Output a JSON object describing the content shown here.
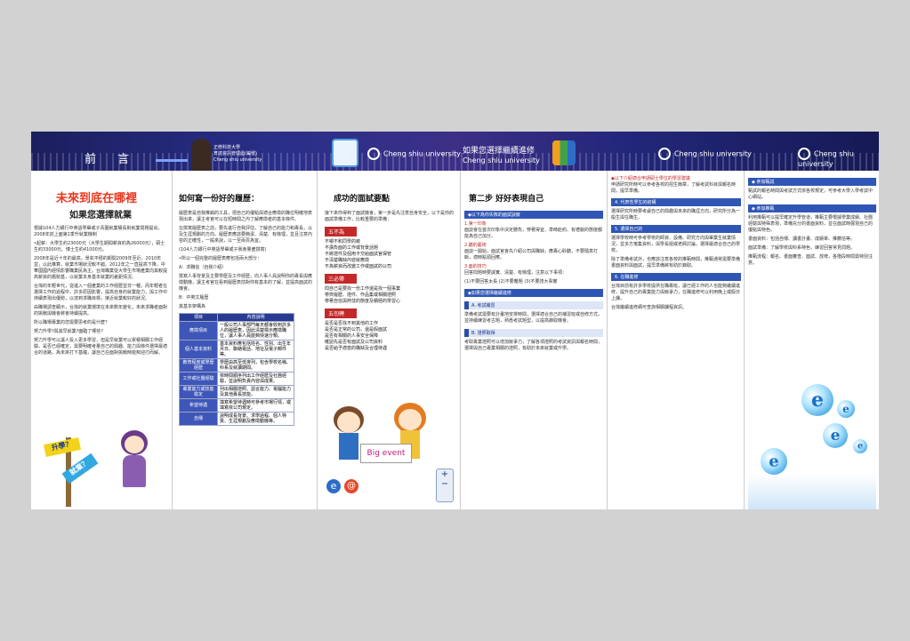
{
  "header": {
    "section_title": "前  言",
    "person_caption": [
      "正修科技大學",
      "育達資訊管理處(編號)",
      "Cheng shiu university"
    ],
    "brand_name": "Cheng shiu university",
    "panel3_title": "如果您選擇繼續進修"
  },
  "panel1": {
    "title": "未來到底在哪裡",
    "subtitle": "如果您選擇就業",
    "paragraphs": [
      "根據104人力銀行中英語學畢或子青園就業權長對就業問題提出，2008年前上面第1季升就業機制",
      "•起薪：大學生約23000元（大學生期間薪資約為26000元），碩士生約33000元、博士生約41000元。",
      "2008年是近十年的最高，景氣平穩的期間2009年至近、2010年並，以此推算，就業市場狀況較不錯。2012年之一直提高下降，中華國國內經情影響職業民為主。台灣職業從大學生市場產業向其較提高薪資的趨勢基，以就業本身基本就業的差距情況。",
      "台灣的年輕世代，從進入一個產業的工作經歷並非一種，而年輕者在選擇工作的過程中，許多原因影響，提高自身的就業能力，與工作中持續表現出優勢，以達到求職目標，接近就業較好的狀況。",
      "由職場調查顯示，台灣的就業環境在未來數年變化，未來求職者面對的挑戰與機會將會持續提高。",
      "所以職場專業的您需要思考的是什麼？",
      "努力升學?與其早就業?面臨了哪些?",
      "努力升學可以讓人投入更多學習，但是早就業可以累積相關工作經驗。是否已經確定，需要明確考量自己的興趣、能力與條件選擇最適合的道路，為未來打下基礎，讓自己在面對挑戰時能夠迎刃而解。"
    ],
    "sign_study": "升學？",
    "sign_work": "就業？"
  },
  "panel2": {
    "title": "如何寫一份好的履歷：",
    "paragraphs": [
      "履歷表是自我推銷的工具，把自己的優點與適合應徵的職位明確地表現出來，讓主考官可以在短時間之內了解應徵者的基本條件。",
      "在撰寫履歷表之前，要先進行自我評估，了解自己的能力和專長，以及生涯規劃的方向。履歷表應該要簡潔、清楚、有條理，並且注意內容的正確性，一般來說，以一至兩頁為宜。",
      "(104人力銀行中英語學畢或子我會量產撰寫)",
      "•所以一個完整的履歷表應包括兩大部分：",
      "A：求職信（自我介紹）",
      "撰寫人事背景及主要學歷及工作經歷，向人事人員說明你的專長與應徵動機，讓主考官在看到履歷表前對你有基本的了解，並提高面試的機會。",
      "B：中英文履歷",
      "其基本架構為"
    ],
    "table_headers": [
      "項目",
      "內容說明"
    ],
    "table_rows": [
      [
        "應徵項目",
        "一般公司人事部門每天都會收到許多人的履歷表，因此清楚標示應徵職位，讓人事人員能夠快速分類。"
      ],
      [
        "個人基本資料",
        "基本資料應包括姓名、性別、出生年月日、聯絡電話、地址及電子郵件等。"
      ],
      [
        "教育程度或學歷經歷",
        "學歷由高至低排列，包含學校名稱、科系及就讀期間。"
      ],
      [
        "工作或社團經驗",
        "依時間順序列出工作經歷及社團經驗，並說明負責內容與成果。"
      ],
      [
        "專業能力或技能檢定",
        "列出相關證照、語言能力、電腦能力及其他專長技能。"
      ],
      [
        "希望待遇",
        "填寫希望待遇時可參考市場行情，或填寫依公司規定。"
      ],
      [
        "自傳",
        "說明成長背景、求學過程、個人特質、生涯規劃及應徵動機等。"
      ]
    ]
  },
  "panel3": {
    "title": "成功的面試要點",
    "intro": "接下來你得到了面試機會，第一步是先注意自身安全，以下是你的面試準備工作，比較重要的準備：",
    "sections": [
      {
        "label": "五不為",
        "items": [
          "不嚼不和同學的敘",
          "不講負面的工作或背景話題",
          "不將證件及個用卡交給面試官保管",
          "不清楚職缺內容就應徵",
          "不為薪資而改變工作或面試的公司"
        ]
      },
      {
        "label": "三必帶",
        "items": [
          "問自己是要找一份工作還是找一個事業",
          "帶齊履歷、證件、作品集或相關證照",
          "帶著自信與熱忱的態度及積極的學習心"
        ]
      },
      {
        "label": "五勿聘",
        "items": [
          "是否是否找不到其他的工作",
          "是否是正常的公司，還是假面試",
          "是否有相關的人事安全保障",
          "確認先是否有面試及公司資料",
          "是否給予適當的職缺及合理待遇"
        ]
      }
    ],
    "sign_text": "Big event"
  },
  "panel4": {
    "title": "第二步 好好表現自己",
    "bars": [
      "◆以下為你失敗的面試訣竅",
      "◆如果您選擇繼續進修"
    ],
    "items": [
      {
        "label": "1.第一印象",
        "text": "面談會在首次印象中決定勝負，穿著得宜、準時赴約、有禮貌的態度都能為自己加分。"
      },
      {
        "label": "2.聽的藝術",
        "text": "面談一開始，面試官會先介紹公司與職缺，應專心聆聽，不要隨意打斷，適時點頭回應。"
      },
      {
        "label": "3.面的技巧",
        "text": "回答問題時要誠實、清楚、有條理，注意以下事項："
      },
      {
        "label": "",
        "text": "(1)不要回答太長    (2)不要離題    (3)不要誇大事實"
      }
    ],
    "sub_bars": [
      "A. 考試補習",
      "B. 證照取得"
    ],
    "sub_texts": [
      "準備考試需要有計畫地安排時間，選擇適合自己的補習班或自修方式，並持續練習考古題，熟悉考試題型，以提高錄取機會。",
      "考取專業證照可以增加競爭力，了解各項證照的考試資訊與報名時間，選擇與自己專業相關的證照，有助於未來就業或升學。"
    ]
  },
  "panel5": {
    "top_note": "◆以下介紹適合申請碩士學位的學習建議",
    "top_text": "申請研究所時可以參考各校的招生簡章，了解考試科目與報名時間，提早準備。",
    "bars": [
      "4. 代表性學生的結構",
      "5. 選擇自己的",
      "6. 在職進修"
    ],
    "texts": [
      "選擇研究所時要考慮自己的興趣與未來的職涯方向，研究所分為一般生與在職生。",
      "選擇學校時可參考學校的師資、設備、研究方向與畢業生就業情況，並多方蒐集資料，與學長姐或老師討論，選擇最適合自己的學校。",
      "除了準備考試外，也應該注意各校的推甄時間，推甄通常需要準備書面資料與面試，提早準備將有助於錄取。",
      "台灣目前有許多學校提供在職專班，讓已經工作的人也能夠繼續進修，提升自己的專業能力與競爭力，在職進修可以利用晚上或假日上課。",
      "台灣繼續進修網可查詢相關課程資訊。"
    ]
  },
  "panel6": {
    "bars": [
      "◆ 參加甄試",
      "◆ 參加推甄"
    ],
    "texts": [
      "甄試的報名時間與考試方式依各校規定，可參考大學入學考試中心網站。",
      "利用推甄可以提早確定升學管道，推甄主要根據學業成績、社團經驗與特殊表現，準備充分的書面資料，並在面試時展現自己的優點與特色。",
      "書面資料：包括自傳、讀書計畫、成績單、推薦信等。",
      "面試準備：了解學校與科系特色，練習回答常見問題。",
      "推甄流程：報名、書面審查、面試、放榜，各階段時間需特別注意。"
    ]
  }
}
